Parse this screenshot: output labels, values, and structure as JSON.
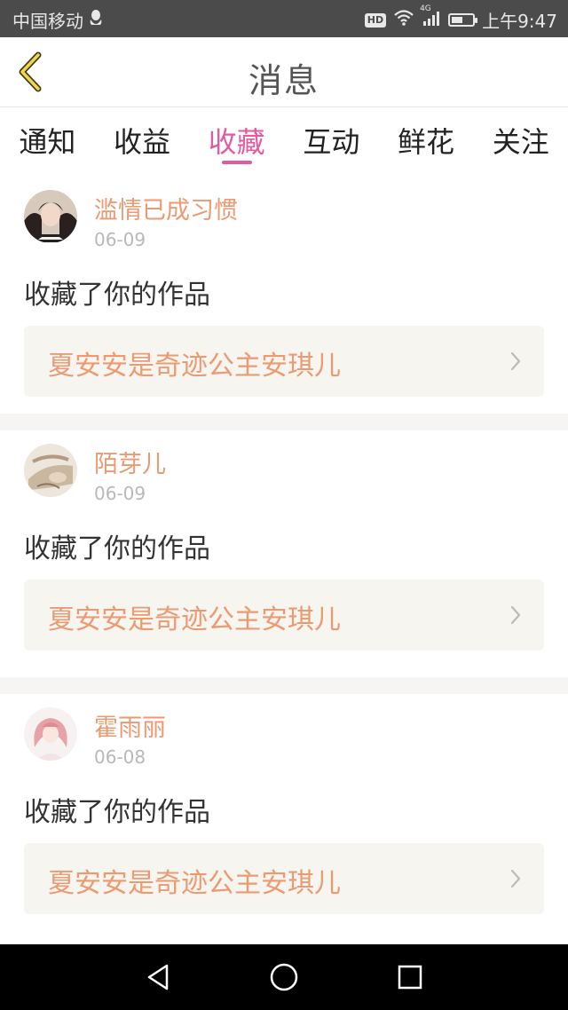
{
  "status_bar": {
    "carrier": "中国移动",
    "hd": "HD",
    "network": "4G",
    "time": "上午9:47",
    "battery_level": 0.55
  },
  "header": {
    "title": "消息"
  },
  "tabs": [
    {
      "label": "通知",
      "active": false
    },
    {
      "label": "收益",
      "active": false
    },
    {
      "label": "收藏",
      "active": true
    },
    {
      "label": "互动",
      "active": false
    },
    {
      "label": "鲜花",
      "active": false
    },
    {
      "label": "关注",
      "active": false
    }
  ],
  "items": [
    {
      "username": "滥情已成习惯",
      "date": "06-09",
      "action": "收藏了你的作品",
      "work_title": "夏安安是奇迹公主安琪儿"
    },
    {
      "username": "陌芽儿",
      "date": "06-09",
      "action": "收藏了你的作品",
      "work_title": "夏安安是奇迹公主安琪儿"
    },
    {
      "username": "霍雨丽",
      "date": "06-08",
      "action": "收藏了你的作品",
      "work_title": "夏安安是奇迹公主安琪儿"
    }
  ],
  "colors": {
    "accent": "#e05c9f",
    "name": "#ec9a72",
    "link_bg": "#f6f5f0"
  }
}
